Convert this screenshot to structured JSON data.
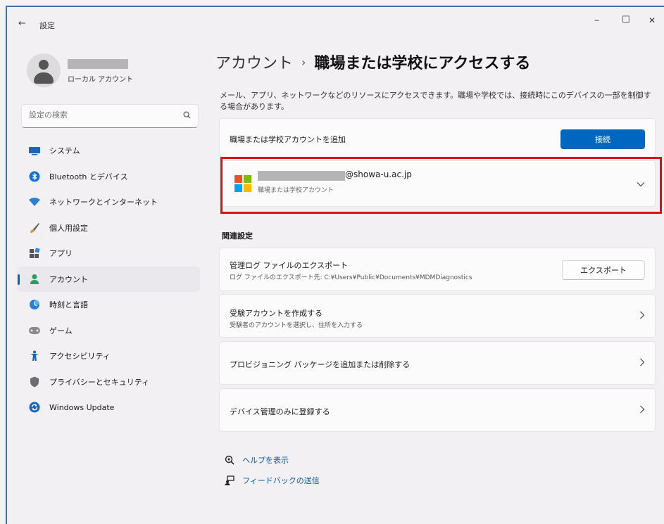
{
  "window": {
    "back_glyph": "←",
    "title": "設定",
    "minimize": "–",
    "maximize": "☐",
    "close": "✕"
  },
  "profile": {
    "subtitle": "ローカル アカウント"
  },
  "search": {
    "placeholder": "設定の検索",
    "icon": "search-icon"
  },
  "sidebar": {
    "items": [
      {
        "label": "システム",
        "icon": "system-icon"
      },
      {
        "label": "Bluetooth とデバイス",
        "icon": "bluetooth-icon"
      },
      {
        "label": "ネットワークとインターネット",
        "icon": "network-icon"
      },
      {
        "label": "個人用設定",
        "icon": "personalization-icon"
      },
      {
        "label": "アプリ",
        "icon": "apps-icon"
      },
      {
        "label": "アカウント",
        "icon": "accounts-icon",
        "active": true
      },
      {
        "label": "時刻と言語",
        "icon": "time-language-icon"
      },
      {
        "label": "ゲーム",
        "icon": "gaming-icon"
      },
      {
        "label": "アクセシビリティ",
        "icon": "accessibility-icon"
      },
      {
        "label": "プライバシーとセキュリティ",
        "icon": "privacy-icon"
      },
      {
        "label": "Windows Update",
        "icon": "windows-update-icon"
      }
    ]
  },
  "breadcrumb": {
    "root": "アカウント",
    "separator": "›",
    "current": "職場または学校にアクセスする"
  },
  "description": "メール、アプリ、ネットワークなどのリソースにアクセスできます。職場や学校では、接続時にこのデバイスの一部を制御する場合があります。",
  "add_account": {
    "label": "職場または学校アカウントを追加",
    "button": "接続"
  },
  "account": {
    "domain": "@showa-u.ac.jp",
    "type": "職場または学校アカウント"
  },
  "related": {
    "title": "関連設定",
    "export_title": "管理ログ ファイルのエクスポート",
    "export_desc": "ログ ファイルのエクスポート先: C:¥Users¥Public¥Documents¥MDMDiagnostics",
    "export_button": "エクスポート",
    "exam_title": "受験アカウントを作成する",
    "exam_desc": "受験者のアカウントを選択し、住所を入力する",
    "provisioning_title": "プロビジョニング パッケージを追加または削除する",
    "mdm_title": "デバイス管理のみに登録する"
  },
  "links": {
    "help": "ヘルプを表示",
    "feedback": "フィードバックの送信"
  },
  "colors": {
    "accent": "#0067c0",
    "highlight": "#e01010",
    "window_border": "#3a6fb0"
  }
}
